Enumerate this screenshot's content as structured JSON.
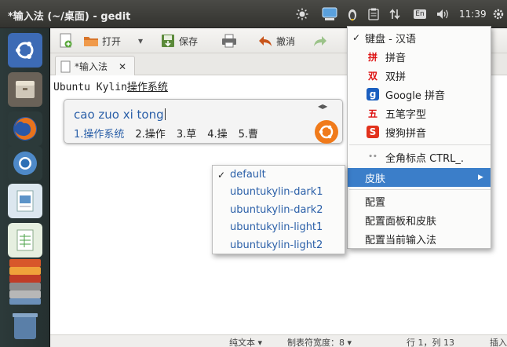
{
  "window_title": "*输入法 (~/桌面) - gedit",
  "tray": {
    "keyboard": "En",
    "clock": "11:39"
  },
  "toolbar": {
    "open_label": "打开",
    "save_label": "保存",
    "undo_label": "撤消",
    "open_arrow": "▾"
  },
  "tabs": [
    {
      "label": "*输入法",
      "close": "✕"
    }
  ],
  "editor": {
    "committed": "Ubuntu Kylin",
    "preedit": "操作系统"
  },
  "ime_popup": {
    "preedit": "cao zuo xi tong",
    "pager": "◀▶",
    "candidates": [
      "1.操作系统",
      "2.操作",
      "3.草",
      "4.操",
      "5.曹"
    ]
  },
  "context_menu": {
    "items": [
      {
        "check": "✓",
        "icon": "",
        "label": "键盘 - 汉语"
      },
      {
        "check": "",
        "icon": "拼",
        "icon_color": "#d11",
        "label": "拼音"
      },
      {
        "check": "",
        "icon": "双",
        "icon_color": "#d11",
        "label": "双拼"
      },
      {
        "check": "",
        "icon": "g",
        "icon_color": "#1b5fbf",
        "label": "Google 拼音"
      },
      {
        "check": "",
        "icon": "五",
        "icon_color": "#d11",
        "label": "五笔字型"
      },
      {
        "check": "",
        "icon": "S",
        "icon_color": "#e2321c",
        "label": "搜狗拼音"
      },
      {
        "check": "",
        "icon": "••",
        "icon_color": "#999",
        "label": "全角标点  CTRL_."
      },
      {
        "check": "",
        "icon": "",
        "label": "皮肤",
        "submenu_arrow": "▶"
      },
      {
        "check": "",
        "icon": "",
        "label": "配置"
      },
      {
        "check": "",
        "icon": "",
        "label": "配置面板和皮肤"
      },
      {
        "check": "",
        "icon": "",
        "label": "配置当前输入法"
      }
    ]
  },
  "skin_submenu": {
    "items": [
      {
        "check": "✓",
        "label": "default"
      },
      {
        "check": "",
        "label": "ubuntukylin-dark1"
      },
      {
        "check": "",
        "label": "ubuntukylin-dark2"
      },
      {
        "check": "",
        "label": "ubuntukylin-light1"
      },
      {
        "check": "",
        "label": "ubuntukylin-light2"
      }
    ]
  },
  "statusbar": {
    "syntax": "纯文本 ▾",
    "tab_width": "制表符宽度：8 ▾",
    "position": "行 1，列 13",
    "mode": "插入"
  },
  "colors": {
    "accent": "#3b7ec9",
    "candidate_text": "#2a5fa8",
    "panel": "#3d3d39",
    "launcher": "#2c3a3a"
  }
}
